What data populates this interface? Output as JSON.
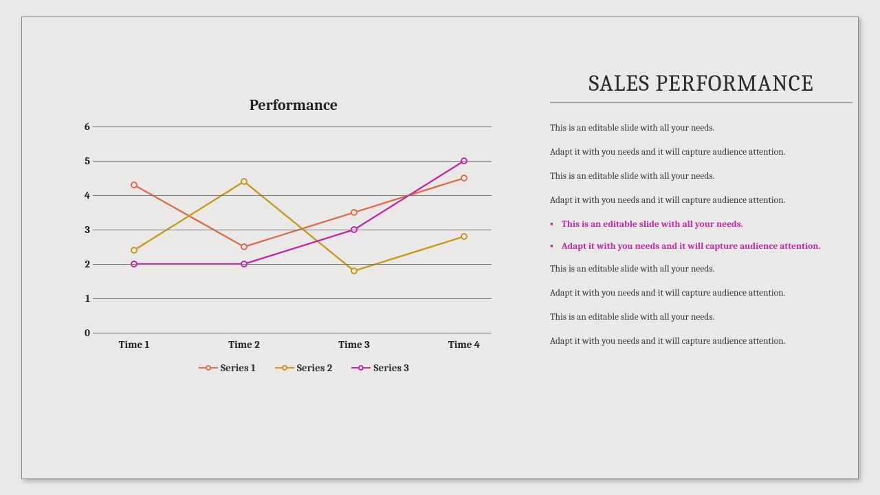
{
  "slide": {
    "main_title": "SALES PERFORMANCE",
    "bullets": {
      "p1": "This is an editable slide with all your needs.",
      "p2": "Adapt it with you needs and it will capture audience attention.",
      "p3": "This is an editable slide with all your needs.",
      "p4": "Adapt it with you needs and it will capture audience attention.",
      "h1": "This is an editable slide with all your needs.",
      "h2": "Adapt it with you needs and it will capture audience attention.",
      "p5": "This is an editable slide with all your needs.",
      "p6": "Adapt it with you needs and it will capture audience attention.",
      "p7": "This is an editable slide with all your needs.",
      "p8": "Adapt it with you needs and it will capture audience attention."
    }
  },
  "chart_data": {
    "type": "line",
    "title": "Performance",
    "categories": [
      "Time 1",
      "Time 2",
      "Time 3",
      "Time 4"
    ],
    "ylim": [
      0,
      6
    ],
    "yticks": [
      0,
      1,
      2,
      3,
      4,
      5,
      6
    ],
    "series": [
      {
        "name": "Series 1",
        "color": "#d96f4a",
        "values": [
          4.3,
          2.5,
          3.5,
          4.5
        ]
      },
      {
        "name": "Series 2",
        "color": "#c59a1a",
        "values": [
          2.4,
          4.4,
          1.8,
          2.8
        ]
      },
      {
        "name": "Series 3",
        "color": "#c22aa5",
        "values": [
          2.0,
          2.0,
          3.0,
          5.0
        ]
      }
    ]
  }
}
